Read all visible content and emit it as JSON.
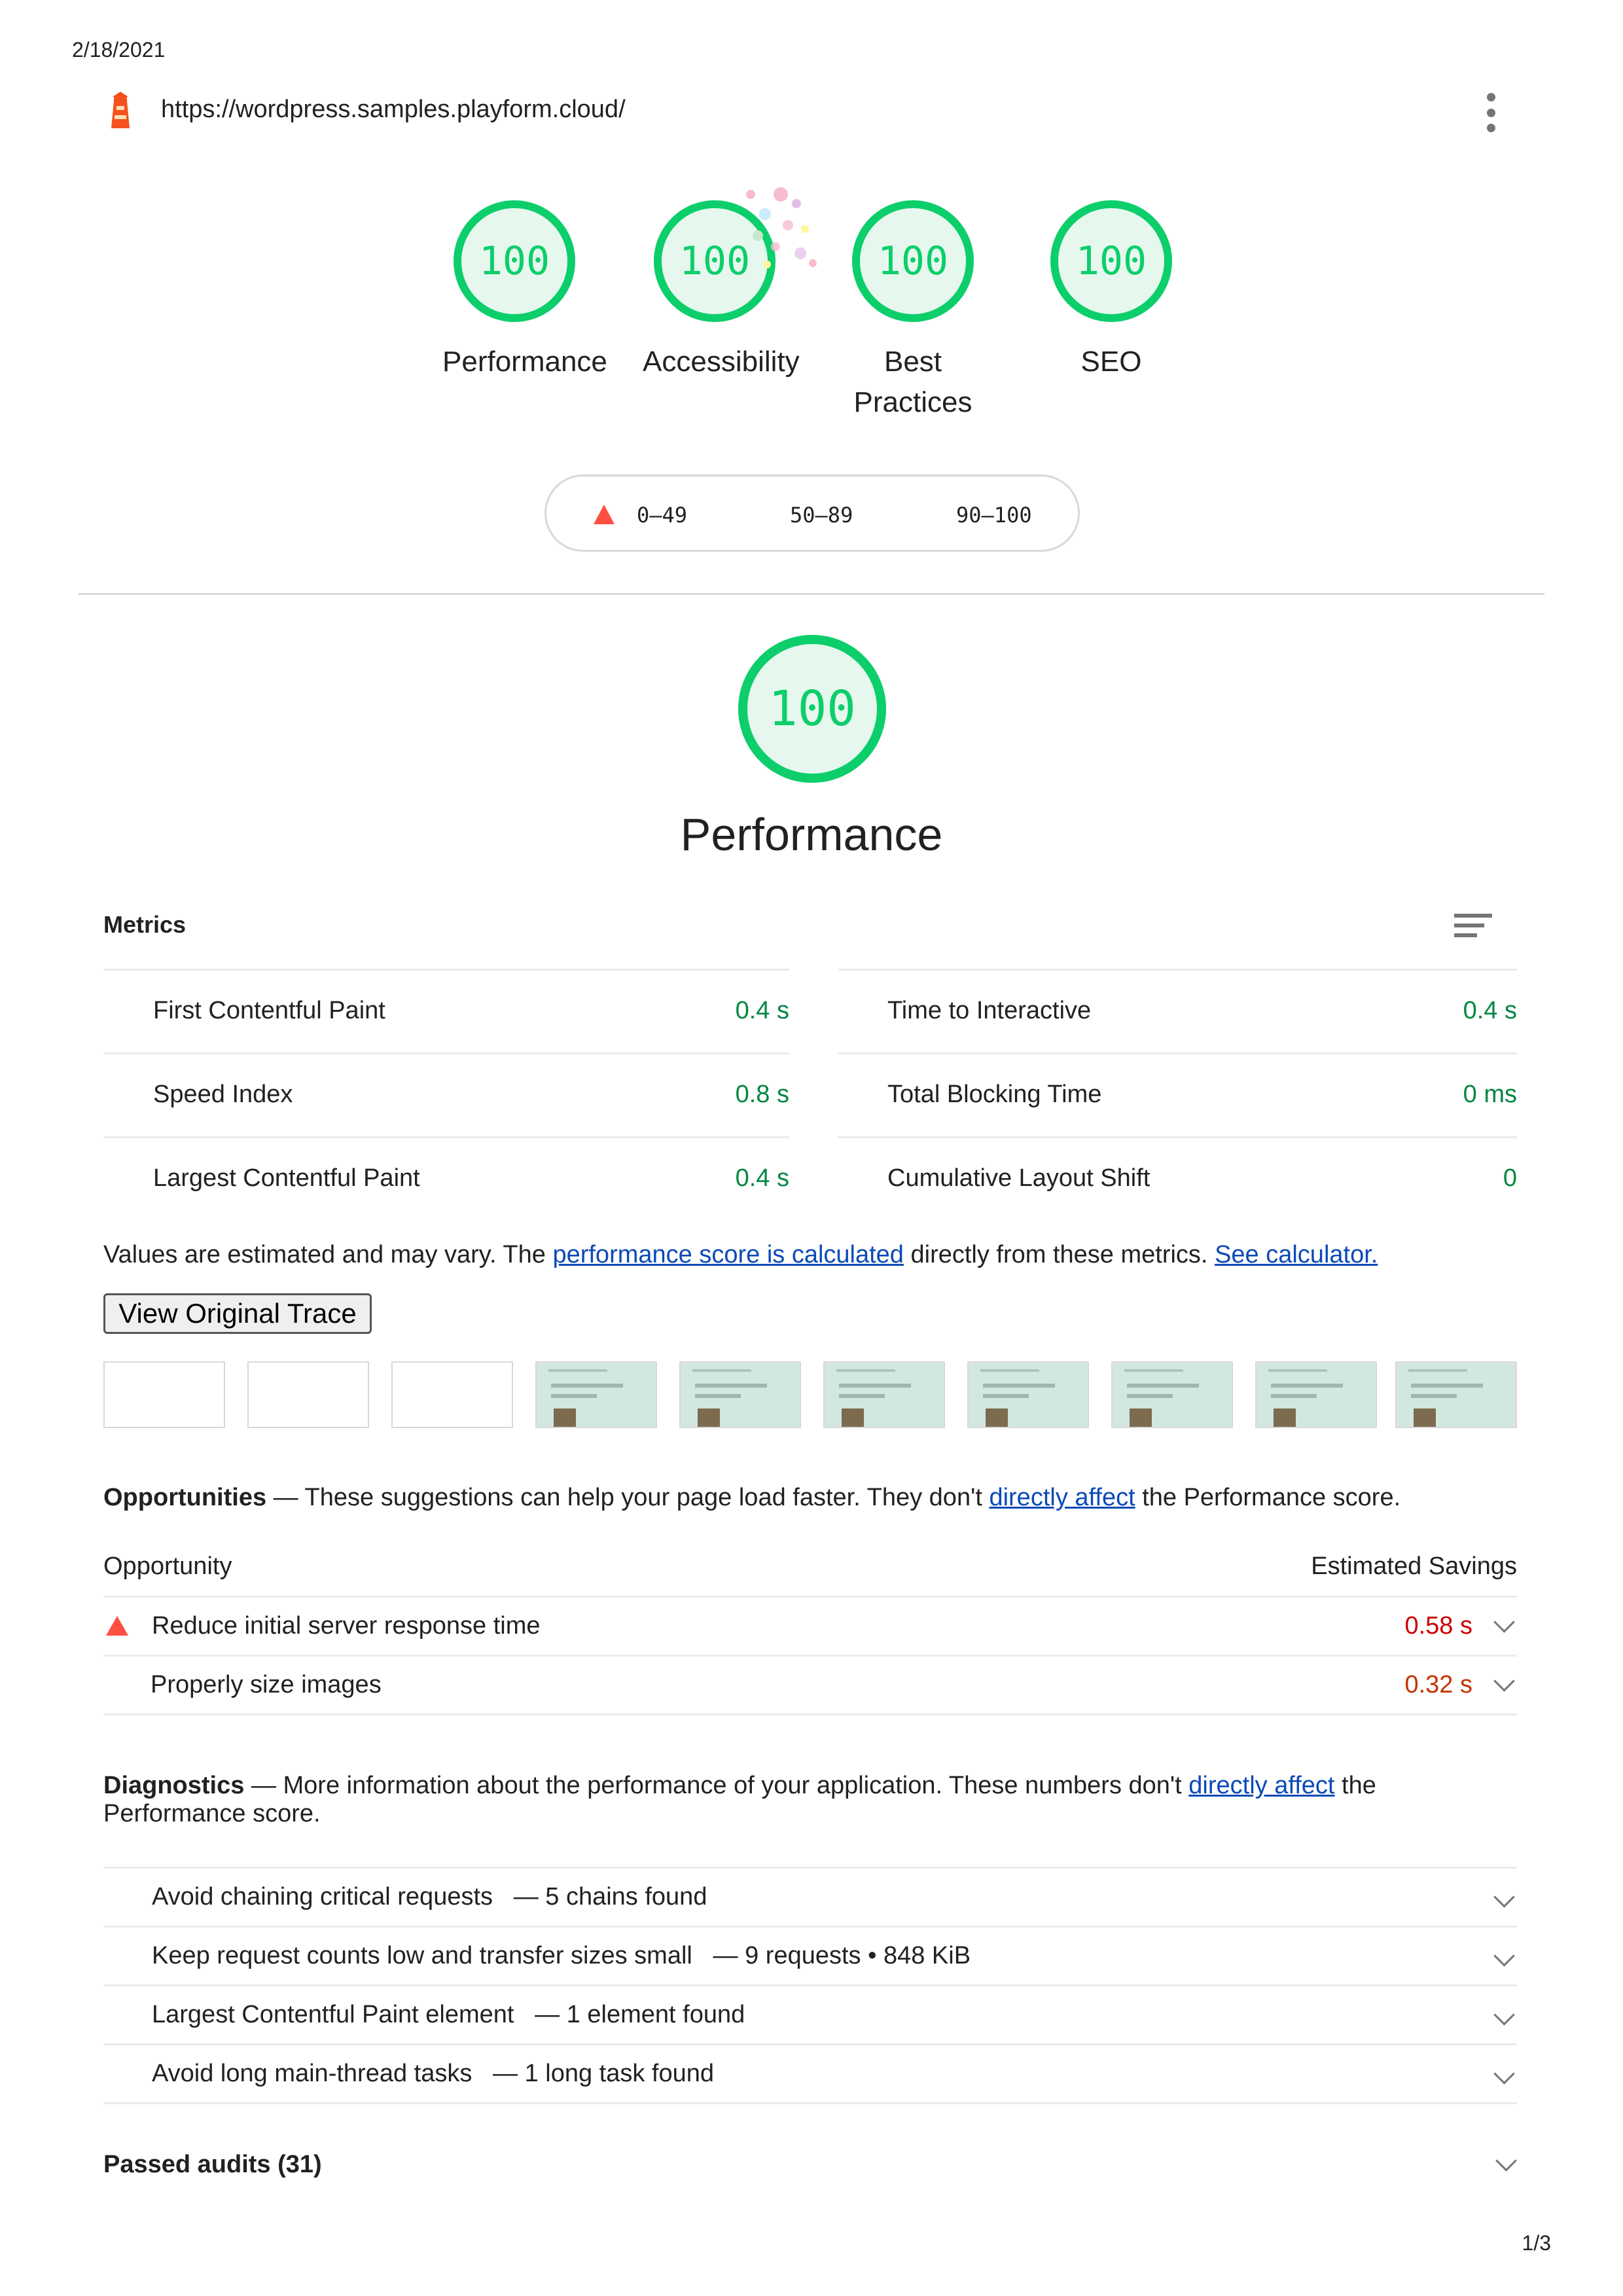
{
  "page": {
    "date": "2/18/2021",
    "page_number": "1/3"
  },
  "header": {
    "url": "https://wordpress.samples.playform.cloud/",
    "logo_icon": "lighthouse-icon",
    "menu_icon": "kebab-menu-icon"
  },
  "gauges": [
    {
      "score": "100",
      "label": "Performance"
    },
    {
      "score": "100",
      "label": "Accessibility"
    },
    {
      "score": "100",
      "label_line1": "Best",
      "label_line2": "Practices"
    },
    {
      "score": "100",
      "label": "SEO"
    }
  ],
  "legend": {
    "fail": "0–49",
    "average": "50–89",
    "pass": "90–100"
  },
  "performance": {
    "score": "100",
    "title": "Performance",
    "metrics_title": "Metrics",
    "metrics": [
      {
        "name": "First Contentful Paint",
        "value": "0.4 s"
      },
      {
        "name": "Time to Interactive",
        "value": "0.4 s"
      },
      {
        "name": "Speed Index",
        "value": "0.8 s"
      },
      {
        "name": "Total Blocking Time",
        "value": "0 ms"
      },
      {
        "name": "Largest Contentful Paint",
        "value": "0.4 s"
      },
      {
        "name": "Cumulative Layout Shift",
        "value": "0"
      }
    ],
    "note_prefix": "Values are estimated and may vary. The ",
    "note_link1": "performance score is calculated",
    "note_middle": " directly from these metrics. ",
    "note_link2": "See calculator.",
    "trace_button": "View Original Trace"
  },
  "opportunities": {
    "title": "Opportunities",
    "desc_prefix": " — These suggestions can help your page load faster. They don't ",
    "desc_link": "directly affect",
    "desc_suffix": " the Performance score.",
    "col_opportunity": "Opportunity",
    "col_savings": "Estimated Savings",
    "items": [
      {
        "label": "Reduce initial server response time",
        "savings": "0.58 s",
        "color": "#cc0000"
      },
      {
        "label": "Properly size images",
        "savings": "0.32 s",
        "color": "#c33300"
      }
    ]
  },
  "diagnostics": {
    "title": "Diagnostics",
    "desc_prefix": " — More information about the performance of your application. These numbers don't ",
    "desc_link": "directly affect",
    "desc_suffix": " the",
    "desc_line2": "Performance score.",
    "items": [
      {
        "label": "Avoid chaining critical requests",
        "detail": "— 5 chains found"
      },
      {
        "label": "Keep request counts low and transfer sizes small",
        "detail": "— 9 requests • 848 KiB"
      },
      {
        "label": "Largest Contentful Paint element",
        "detail": "— 1 element found"
      },
      {
        "label": "Avoid long main-thread tasks",
        "detail": "— 1 long task found"
      }
    ]
  },
  "passed_audits": "Passed audits (31)",
  "colors": {
    "pass": "#0cce6b",
    "pass_text": "#018642",
    "fail": "#ff4e42",
    "link": "#0b4ab7"
  }
}
